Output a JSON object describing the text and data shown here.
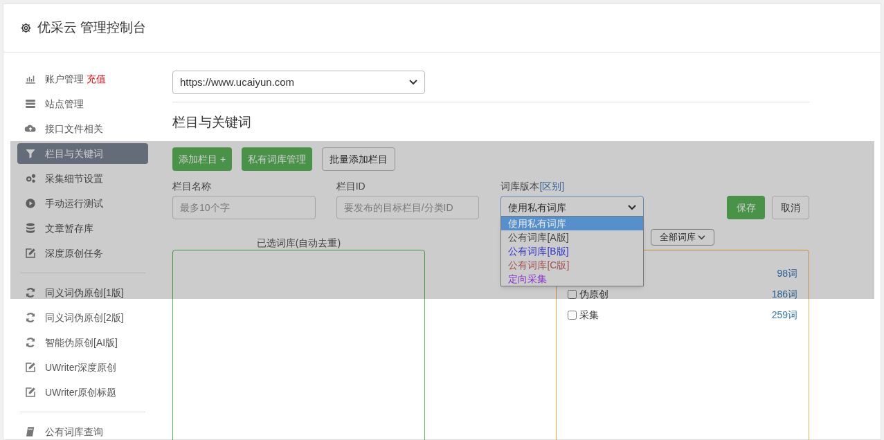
{
  "header": {
    "title": "优采云 管理控制台"
  },
  "sidebar": {
    "groups": [
      {
        "items": [
          {
            "label": "账户管理",
            "badge": "充值",
            "selected": false
          },
          {
            "label": "站点管理",
            "selected": false
          },
          {
            "label": "接口文件相关",
            "selected": false
          },
          {
            "label": "栏目与关键词",
            "selected": true
          },
          {
            "label": "采集细节设置",
            "selected": false
          },
          {
            "label": "手动运行测试",
            "selected": false
          },
          {
            "label": "文章暂存库",
            "selected": false
          },
          {
            "label": "深度原创任务",
            "selected": false
          }
        ]
      },
      {
        "items": [
          {
            "label": "同义词伪原创[1版]",
            "selected": false
          },
          {
            "label": "同义词伪原创[2版]",
            "selected": false
          },
          {
            "label": "智能伪原创[AI版]",
            "selected": false
          },
          {
            "label": "UWriter深度原创",
            "selected": false
          },
          {
            "label": "UWriter原创标题",
            "selected": false
          }
        ]
      },
      {
        "items": [
          {
            "label": "公有词库查询",
            "selected": false
          }
        ]
      }
    ]
  },
  "site_select": {
    "value": "https://www.ucaiyun.com"
  },
  "section_title": "栏目与关键词",
  "toolbar": [
    {
      "label": "添加栏目 +",
      "kind": "primary"
    },
    {
      "label": "私有词库管理",
      "kind": "primary"
    },
    {
      "label": "批量添加栏目",
      "kind": "outline"
    }
  ],
  "form": {
    "name_field": {
      "label": "栏目名称",
      "placeholder": "最多10个字"
    },
    "id_field": {
      "label": "栏目ID",
      "placeholder": "要发布的目标栏目/分类ID"
    },
    "version_select": {
      "label": "词库版本",
      "link": "[区别]",
      "value": "使用私有词库",
      "expanded": true,
      "options": [
        {
          "label": "使用私有词库",
          "selected": true,
          "color": "#e8e8e8"
        },
        {
          "label": "公有词库[A版]",
          "selected": false,
          "color": "#444444"
        },
        {
          "label": "公有词库[B版]",
          "selected": false,
          "color": "#3333cc"
        },
        {
          "label": "公有词库[C版]",
          "selected": false,
          "color": "#a05050"
        },
        {
          "label": "定向采集",
          "selected": false,
          "color": "#8833cc"
        }
      ]
    },
    "save": "保存",
    "cancel": "取消"
  },
  "selected_panel": {
    "title": "已选词库(自动去重)"
  },
  "library_panel": {
    "filter": "全部词库",
    "items": [
      {
        "count": "98词"
      },
      {
        "label": "伪原创",
        "checked": false,
        "count": "186词"
      },
      {
        "label": "采集",
        "checked": false,
        "count": "259词"
      }
    ]
  }
}
